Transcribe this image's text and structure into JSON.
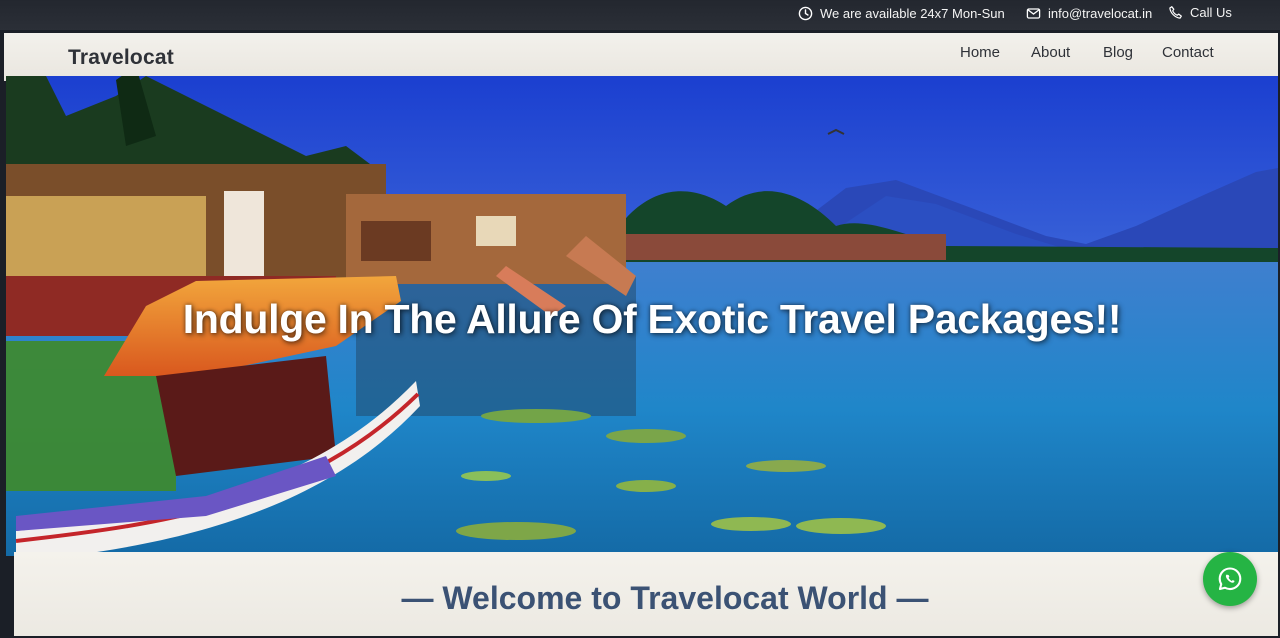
{
  "topbar": {
    "availability": "We are available 24x7 Mon-Sun",
    "email": "info@travelocat.in",
    "call": "Call Us",
    "icons": [
      "clock-icon",
      "mail-icon",
      "phone-icon"
    ]
  },
  "navbar": {
    "brand": "Travelocat",
    "links": [
      "Home",
      "About",
      "Blog",
      "Contact"
    ]
  },
  "hero": {
    "headline": "Indulge In The Allure Of Exotic Travel Packages!!"
  },
  "welcome": {
    "title": "— Welcome to Travelocat World —"
  },
  "floating": {
    "icon": "whatsapp-icon",
    "color": "#25b444"
  }
}
